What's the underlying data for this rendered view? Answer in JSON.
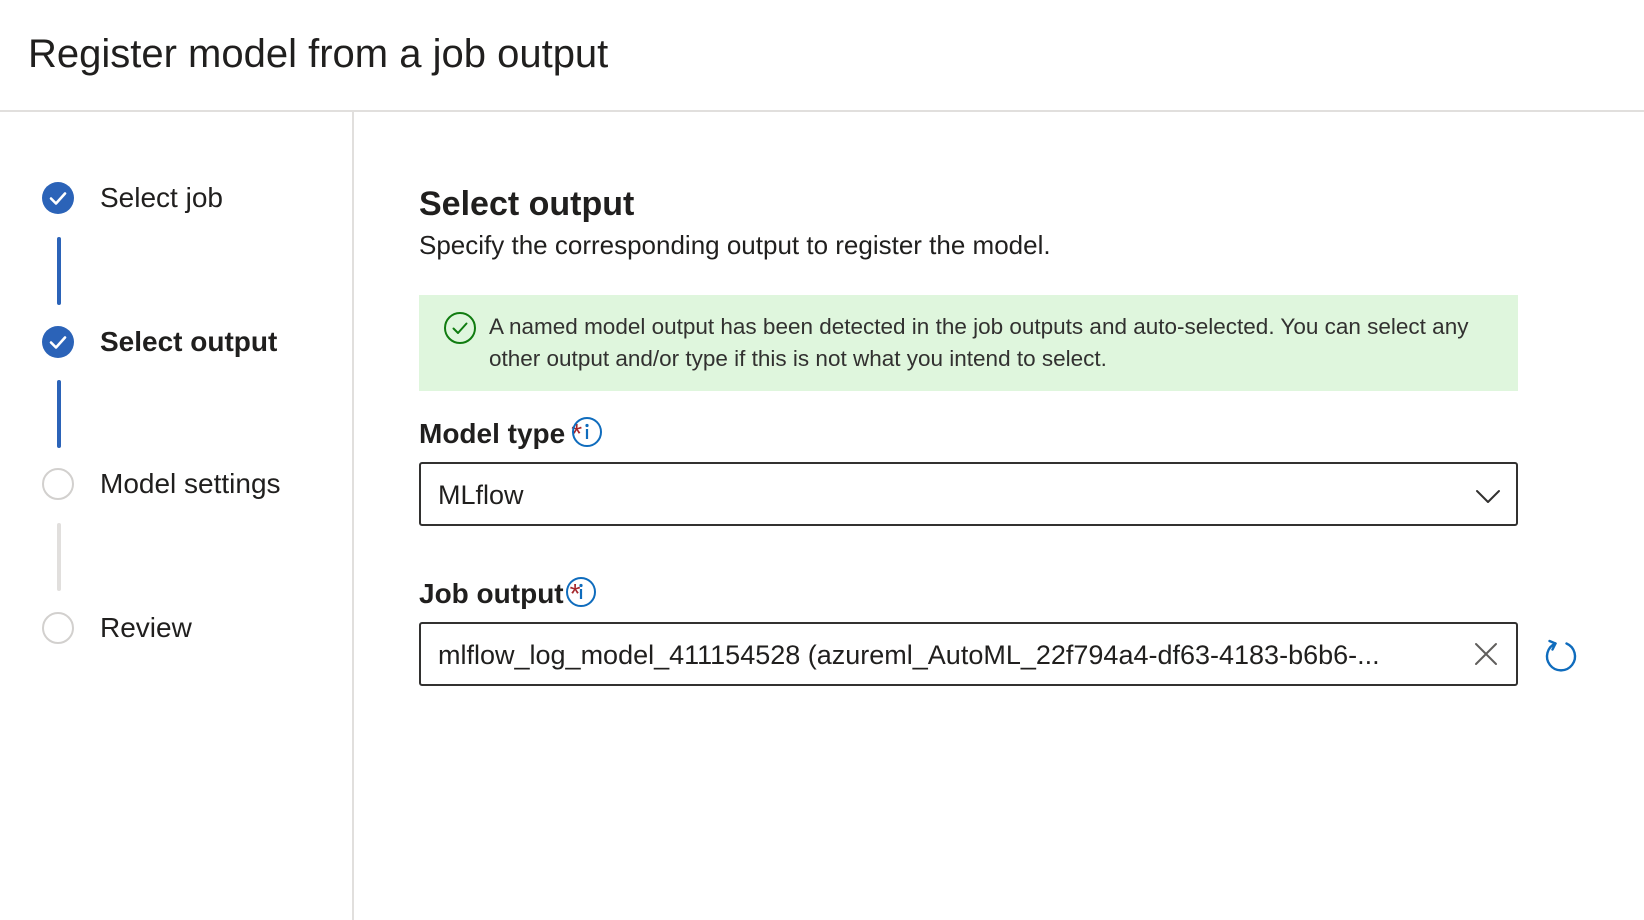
{
  "header": {
    "title": "Register model from a job output"
  },
  "steps": [
    {
      "label": "Select job",
      "status": "completed"
    },
    {
      "label": "Select output",
      "status": "completed",
      "active": true
    },
    {
      "label": "Model settings",
      "status": "pending"
    },
    {
      "label": "Review",
      "status": "pending"
    }
  ],
  "main": {
    "title": "Select output",
    "description": "Specify the corresponding output to register the model.",
    "banner": {
      "icon": "check-circle-icon",
      "text": "A named model output has been detected in the job outputs and auto-selected. You can select any other output and/or type if this is not what you intend to select."
    },
    "model_type": {
      "label": "Model type",
      "required_mark": "*",
      "value": "MLflow"
    },
    "job_output": {
      "label": "Job output",
      "required_mark": "*",
      "value": "mlflow_log_model_411154528 (azureml_AutoML_22f794a4-df63-4183-b6b6-..."
    }
  },
  "colors": {
    "accent": "#2b63b8",
    "success_bg": "#dff6dd",
    "success_icon": "#107c10",
    "required": "#a4262c",
    "info_icon": "#0f6cbd"
  }
}
